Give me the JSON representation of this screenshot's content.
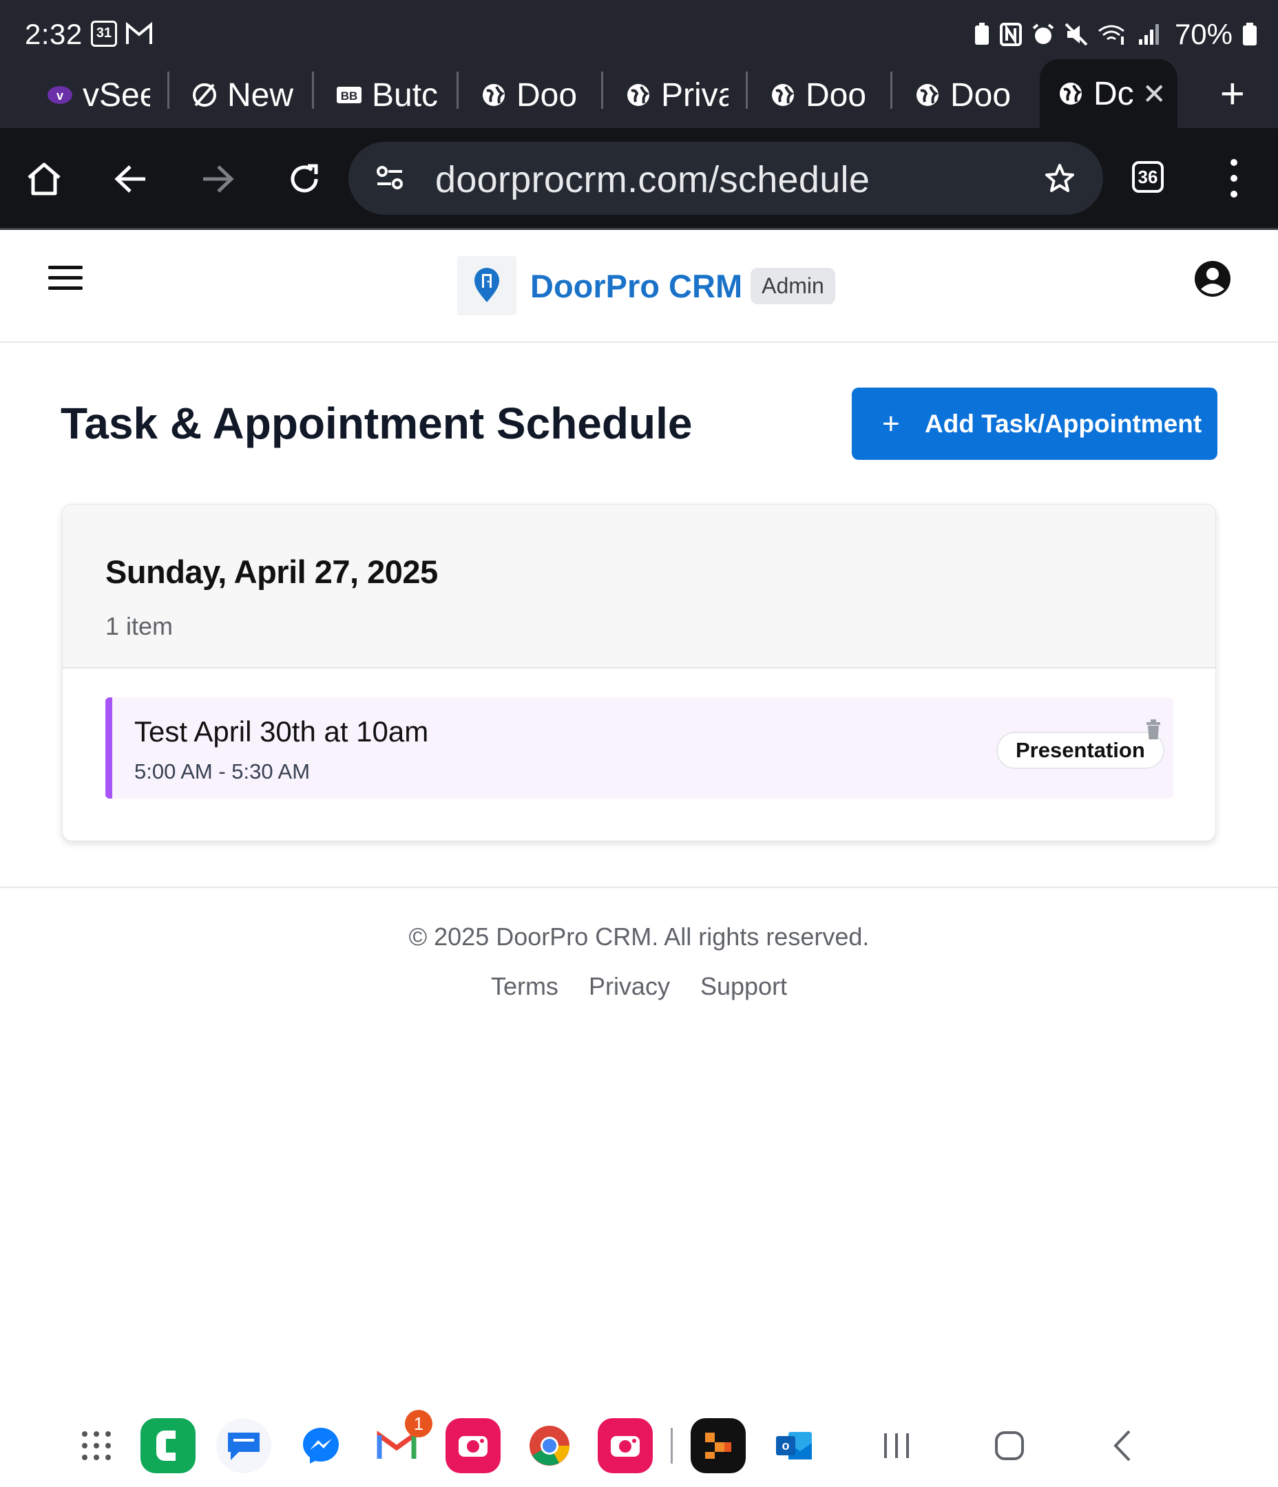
{
  "status_bar": {
    "time": "2:32",
    "calendar_day": "31",
    "battery": "70%"
  },
  "tabs": [
    {
      "label": "vSee",
      "icon": "vsee-icon"
    },
    {
      "label": "New",
      "icon": "no-sign-icon"
    },
    {
      "label": "Butc",
      "icon": "bb-icon"
    },
    {
      "label": "Doo",
      "icon": "globe-icon"
    },
    {
      "label": "Priva",
      "icon": "globe-icon"
    },
    {
      "label": "Doo",
      "icon": "globe-icon"
    },
    {
      "label": "Doo",
      "icon": "globe-icon"
    },
    {
      "label": "Dc",
      "icon": "globe-icon",
      "active": true
    }
  ],
  "browser": {
    "url": "doorprocrm.com/schedule",
    "tab_count": "36"
  },
  "header": {
    "brand": "DoorPro CRM",
    "role_badge": "Admin"
  },
  "main": {
    "title": "Task & Appointment Schedule",
    "add_button": "Add Task/Appointment",
    "days": [
      {
        "date": "Sunday, April 27, 2025",
        "count": "1 item",
        "items": [
          {
            "title": "Test April 30th at 10am",
            "time": "5:00 AM - 5:30 AM",
            "type": "Presentation",
            "accent": "#a855f7"
          }
        ]
      }
    ]
  },
  "footer": {
    "copyright": "© 2025 DoorPro CRM. All rights reserved.",
    "links": [
      "Terms",
      "Privacy",
      "Support"
    ]
  },
  "colors": {
    "brand": "#1a73c9",
    "primary_button": "#0b72d9",
    "chrome_dark": "#23262e"
  },
  "dock": {
    "gmail_badge": "1",
    "apps": [
      "app-drawer",
      "contacts",
      "messages",
      "messenger",
      "gmail",
      "camera",
      "chrome",
      "camera-2",
      "office-app",
      "outlook"
    ]
  }
}
